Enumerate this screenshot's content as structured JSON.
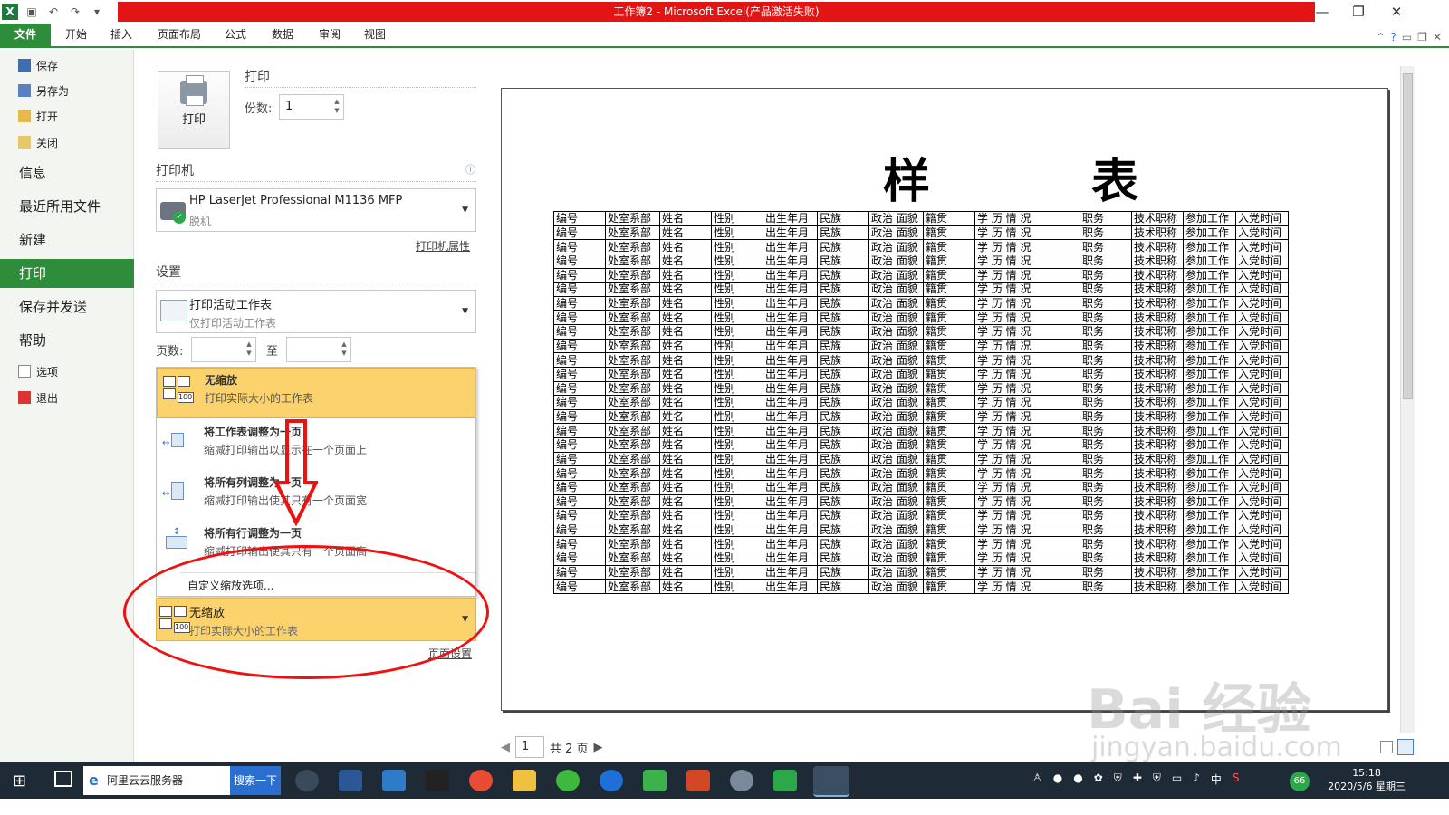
{
  "window": {
    "title": "工作簿2 - Microsoft Excel(产品激活失败)",
    "min": "—",
    "restore": "❐",
    "close": "✕"
  },
  "ribbon": {
    "tabs": [
      "文件",
      "开始",
      "插入",
      "页面布局",
      "公式",
      "数据",
      "审阅",
      "视图"
    ]
  },
  "nav": {
    "save": "保存",
    "saveas": "另存为",
    "open": "打开",
    "close": "关闭",
    "info": "信息",
    "recent": "最近所用文件",
    "new": "新建",
    "print": "打印",
    "savesend": "保存并发送",
    "help": "帮助",
    "options": "选项",
    "exit": "退出"
  },
  "print": {
    "section": "打印",
    "button": "打印",
    "copies_label": "份数:",
    "copies_value": "1",
    "printer_section": "打印机",
    "printer_name": "HP LaserJet Professional M1136 MFP",
    "printer_status": "脱机",
    "printer_props": "打印机属性",
    "settings_section": "设置",
    "what_main": "打印活动工作表",
    "what_sub": "仅打印活动工作表",
    "pages_label": "页数:",
    "pages_to": "至",
    "scaling_options": [
      {
        "title": "无缩放",
        "desc": "打印实际大小的工作表"
      },
      {
        "title": "将工作表调整为一页",
        "desc": "缩减打印输出以显示在一个页面上"
      },
      {
        "title": "将所有列调整为一页",
        "desc": "缩减打印输出使其只有一个页面宽"
      },
      {
        "title": "将所有行调整为一页",
        "desc": "缩减打印输出使其只有一个页面高"
      }
    ],
    "custom_scaling": "自定义缩放选项...",
    "scaling_selected_title": "无缩放",
    "scaling_selected_desc": "打印实际大小的工作表",
    "page_setup": "页面设置"
  },
  "preview": {
    "title": "样 表",
    "header_row": [
      "编号",
      "处室系部",
      "姓名",
      "性别",
      "出生年月",
      "民族",
      "政治 面貌",
      "籍贯",
      "学 历 情 况",
      "职务",
      "技术职称",
      "参加工作",
      "入党时间"
    ],
    "row_count": 27,
    "page_current": "1",
    "page_total": "共 2 页"
  },
  "watermark": {
    "brand": "Bai 经验",
    "url": "jingyan.baidu.com"
  },
  "taskbar": {
    "search_text": "阿里云云服务器",
    "search_button": "搜索一下",
    "ime": "中",
    "time": "15:18",
    "date": "2020/5/6 星期三"
  },
  "colors": {
    "accent": "#2d8d3a",
    "title_bar": "#e21414",
    "highlight": "#fbd26b",
    "annotation": "#e11111"
  }
}
